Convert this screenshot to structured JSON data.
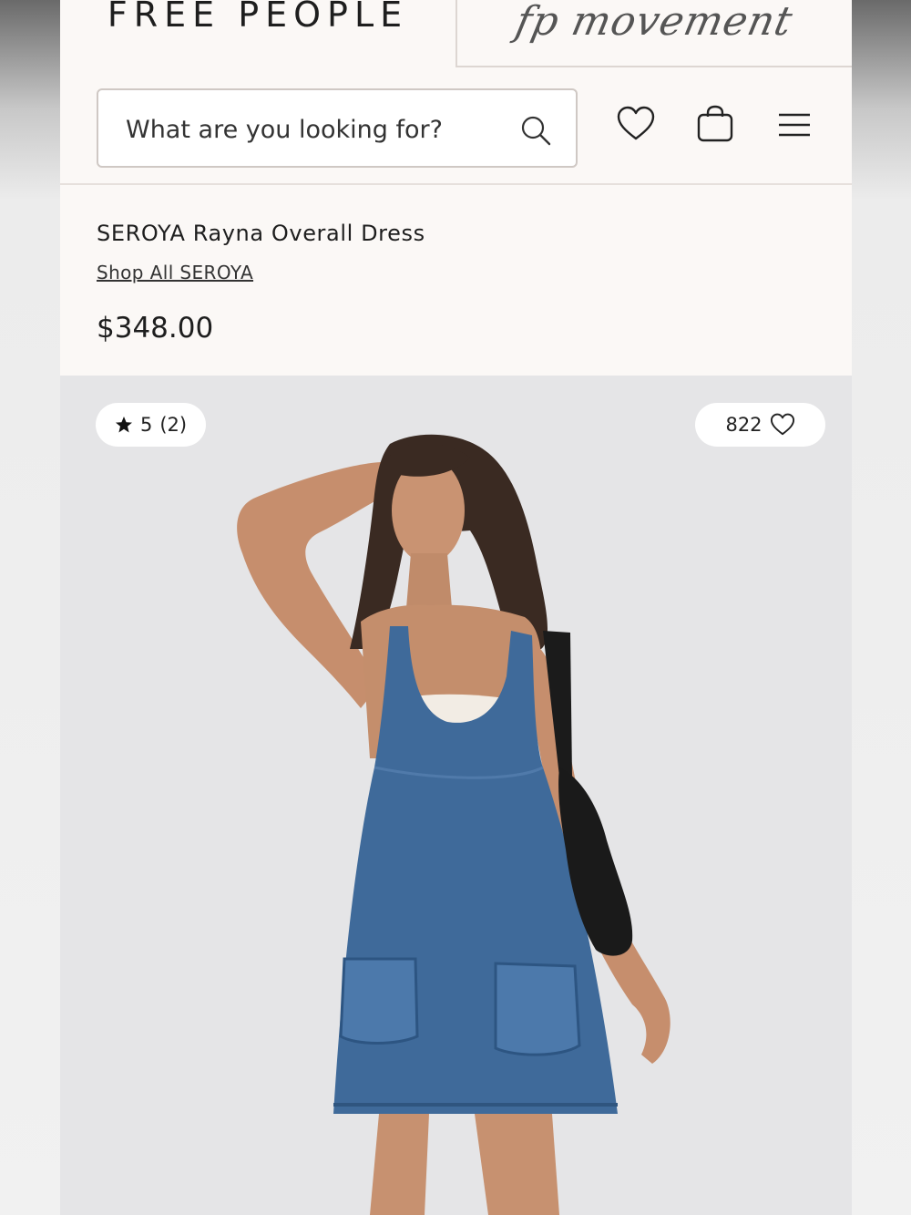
{
  "brand": {
    "primary": "FREE PEOPLE",
    "secondary": "fp movement"
  },
  "search": {
    "placeholder": "What are you looking for?"
  },
  "header_icons": [
    "heart-icon",
    "bag-icon",
    "menu-icon"
  ],
  "product": {
    "title": "SEROYA Rayna Overall Dress",
    "shop_all": "Shop All SEROYA",
    "price": "$348.00"
  },
  "image": {
    "rating": "5",
    "rating_count": "(2)",
    "likes": "822"
  },
  "colors": {
    "background": "#fbf8f6",
    "photo_bg": "#e5e5e7",
    "denim": "#3f6a9a"
  }
}
